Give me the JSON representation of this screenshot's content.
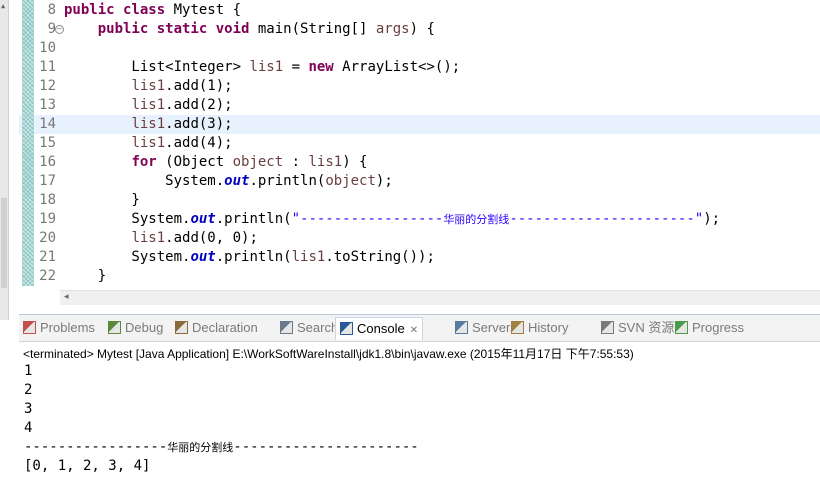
{
  "editor": {
    "lines": [
      {
        "num": "8",
        "tokens": [
          [
            "kw",
            "public class"
          ],
          [
            "n",
            " Mytest {"
          ]
        ]
      },
      {
        "num": "9",
        "tokens": [
          [
            "n",
            "    "
          ],
          [
            "kw",
            "public static void"
          ],
          [
            "n",
            " main(String[] "
          ],
          [
            "var",
            "args"
          ],
          [
            "n",
            ") {"
          ]
        ]
      },
      {
        "num": "10",
        "tokens": []
      },
      {
        "num": "11",
        "tokens": [
          [
            "n",
            "        List<Integer> "
          ],
          [
            "var",
            "lis1"
          ],
          [
            "n",
            " = "
          ],
          [
            "kw",
            "new"
          ],
          [
            "n",
            " ArrayList<>();"
          ]
        ]
      },
      {
        "num": "12",
        "tokens": [
          [
            "n",
            "        "
          ],
          [
            "var",
            "lis1"
          ],
          [
            "n",
            ".add(1);"
          ]
        ]
      },
      {
        "num": "13",
        "tokens": [
          [
            "n",
            "        "
          ],
          [
            "var",
            "lis1"
          ],
          [
            "n",
            ".add(2);"
          ]
        ]
      },
      {
        "num": "14",
        "tokens": [
          [
            "n",
            "        "
          ],
          [
            "var",
            "lis1"
          ],
          [
            "n",
            ".add(3);"
          ]
        ]
      },
      {
        "num": "15",
        "tokens": [
          [
            "n",
            "        "
          ],
          [
            "var",
            "lis1"
          ],
          [
            "n",
            ".add(4);"
          ]
        ]
      },
      {
        "num": "16",
        "tokens": [
          [
            "n",
            "        "
          ],
          [
            "kw",
            "for"
          ],
          [
            "n",
            " (Object "
          ],
          [
            "var",
            "object"
          ],
          [
            "n",
            " : "
          ],
          [
            "var",
            "lis1"
          ],
          [
            "n",
            ") {"
          ]
        ]
      },
      {
        "num": "17",
        "tokens": [
          [
            "n",
            "            System."
          ],
          [
            "fld",
            "out"
          ],
          [
            "n",
            ".println("
          ],
          [
            "var",
            "object"
          ],
          [
            "n",
            ");"
          ]
        ]
      },
      {
        "num": "18",
        "tokens": [
          [
            "n",
            "        }"
          ]
        ]
      },
      {
        "num": "19",
        "tokens": [
          [
            "n",
            "        System."
          ],
          [
            "fld",
            "out"
          ],
          [
            "n",
            ".println("
          ],
          [
            "str",
            "\"-----------------"
          ],
          [
            "strcjk",
            "华丽的分割线"
          ],
          [
            "str",
            "----------------------\""
          ],
          [
            "n",
            ");"
          ]
        ]
      },
      {
        "num": "20",
        "tokens": [
          [
            "n",
            "        "
          ],
          [
            "var",
            "lis1"
          ],
          [
            "n",
            ".add(0, 0);"
          ]
        ]
      },
      {
        "num": "21",
        "tokens": [
          [
            "n",
            "        System."
          ],
          [
            "fld",
            "out"
          ],
          [
            "n",
            ".println("
          ],
          [
            "var",
            "lis1"
          ],
          [
            "n",
            ".toString());"
          ]
        ]
      },
      {
        "num": "22",
        "tokens": [
          [
            "n",
            "    }"
          ]
        ]
      }
    ],
    "current_line": "14",
    "fold_marker_line": "9"
  },
  "tabs": [
    {
      "label": "Problems",
      "icon": "problems-icon",
      "color": "#c05050"
    },
    {
      "label": "Debug",
      "icon": "debug-icon",
      "color": "#5a8a3a"
    },
    {
      "label": "Declaration",
      "icon": "declaration-icon",
      "color": "#8a6a3a"
    },
    {
      "label": "Search",
      "icon": "search-icon",
      "color": "#6a7a8a"
    },
    {
      "label": "Console",
      "icon": "console-icon",
      "color": "#2a5a9a",
      "active": true
    },
    {
      "label": "Servers",
      "icon": "servers-icon",
      "color": "#5a7aa0"
    },
    {
      "label": "History",
      "icon": "history-icon",
      "color": "#a08040"
    },
    {
      "label": "SVN 资源库",
      "icon": "svn-icon",
      "color": "#7a7a7a"
    },
    {
      "label": "Progress",
      "icon": "progress-icon",
      "color": "#4a9a4a"
    }
  ],
  "console": {
    "status": "<terminated> Mytest [Java Application] E:\\WorkSoftWareInstall\\jdk1.8\\bin\\javaw.exe (2015年11月17日 下午7:55:53)",
    "output": [
      "1",
      "2",
      "3",
      "4"
    ],
    "separator_left": "-----------------",
    "separator_cjk": "华丽的分割线",
    "separator_right": "----------------------",
    "final_output": "[0, 1, 2, 3, 4]"
  }
}
